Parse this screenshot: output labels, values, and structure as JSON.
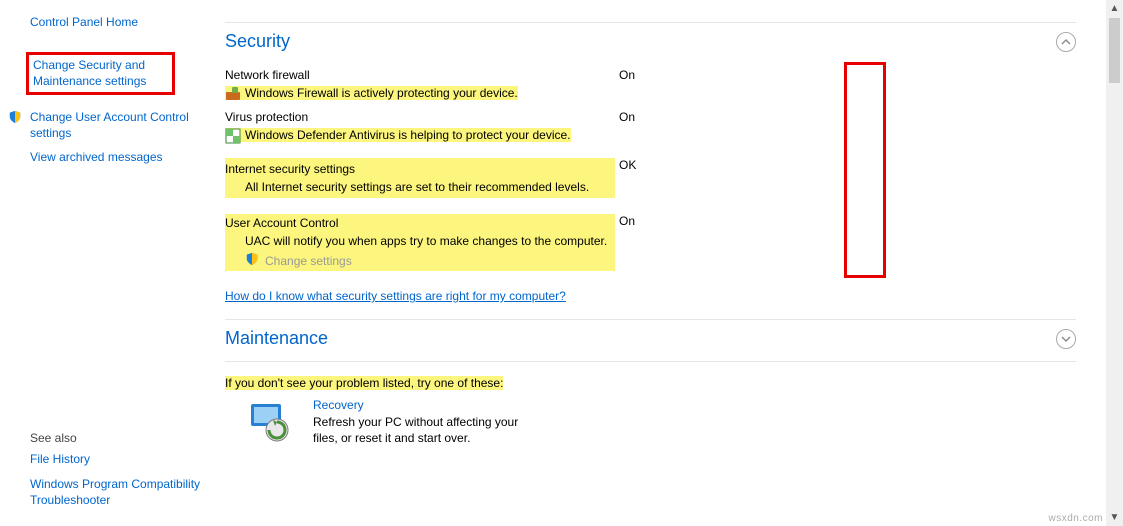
{
  "sidebar": {
    "home": "Control Panel Home",
    "links": [
      "Change Security and Maintenance settings",
      "Change User Account Control settings",
      "View archived messages"
    ],
    "see_also_header": "See also",
    "see_also": [
      "File History",
      "Windows Program Compatibility Troubleshooter"
    ]
  },
  "sections": {
    "security": {
      "title": "Security",
      "firewall": {
        "label": "Network firewall",
        "msg": "Windows Firewall is actively protecting your device.",
        "status": "On"
      },
      "virus": {
        "label": "Virus protection",
        "msg": "Windows Defender Antivirus is helping to protect your device.",
        "status": "On"
      },
      "internet": {
        "label": "Internet security settings",
        "msg": "All Internet security settings are set to their recommended levels.",
        "status": "OK"
      },
      "uac": {
        "label": "User Account Control",
        "msg": "UAC will notify you when apps try to make changes to the computer.",
        "change": "Change settings",
        "status": "On"
      },
      "help_link": "How do I know what security settings are right for my computer?"
    },
    "maintenance": {
      "title": "Maintenance"
    }
  },
  "footer": {
    "prompt": "If you don't see your problem listed, try one of these:",
    "recovery_title": "Recovery",
    "recovery_sub": "Refresh your PC without affecting your files, or reset it and start over."
  },
  "watermark": "wsxdn.com"
}
